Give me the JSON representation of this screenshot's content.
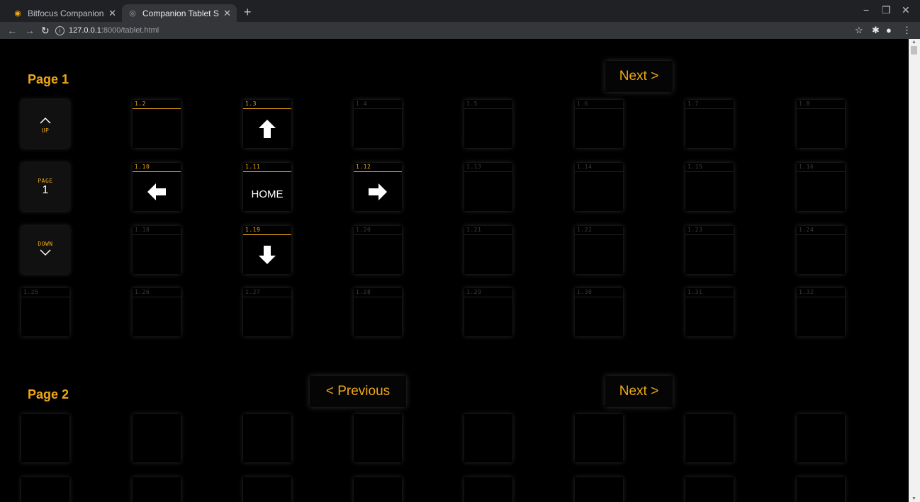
{
  "browser": {
    "tabs": [
      {
        "title": "Bitfocus Companion - Admin",
        "icon": "companion-icon",
        "active": false
      },
      {
        "title": "Companion Tablet Surface",
        "icon": "globe-icon",
        "active": true
      }
    ],
    "url_host": "127.0.0.1",
    "url_path": ":8000/tablet.html"
  },
  "pages": [
    {
      "title": "Page 1",
      "prev_label": "",
      "next_label": "Next >",
      "control": {
        "up": "UP",
        "page_label": "PAGE",
        "page_number": "1",
        "down": "DOWN"
      },
      "buttons": [
        {
          "code": "1.2",
          "lit": true,
          "face": ""
        },
        {
          "code": "1.3",
          "lit": true,
          "face": "arrow-up-icon"
        },
        {
          "code": "1.4",
          "lit": false,
          "face": ""
        },
        {
          "code": "1.5",
          "lit": false,
          "face": ""
        },
        {
          "code": "1.6",
          "lit": false,
          "face": ""
        },
        {
          "code": "1.7",
          "lit": false,
          "face": ""
        },
        {
          "code": "1.8",
          "lit": false,
          "face": ""
        },
        {
          "code": "1.10",
          "lit": true,
          "face": "arrow-left-icon"
        },
        {
          "code": "1.11",
          "lit": true,
          "face": "HOME"
        },
        {
          "code": "1.12",
          "lit": true,
          "face": "arrow-right-icon"
        },
        {
          "code": "1.13",
          "lit": false,
          "face": ""
        },
        {
          "code": "1.14",
          "lit": false,
          "face": ""
        },
        {
          "code": "1.15",
          "lit": false,
          "face": ""
        },
        {
          "code": "1.16",
          "lit": false,
          "face": ""
        },
        {
          "code": "1.18",
          "lit": false,
          "face": ""
        },
        {
          "code": "1.19",
          "lit": true,
          "face": "arrow-down-icon"
        },
        {
          "code": "1.20",
          "lit": false,
          "face": ""
        },
        {
          "code": "1.21",
          "lit": false,
          "face": ""
        },
        {
          "code": "1.22",
          "lit": false,
          "face": ""
        },
        {
          "code": "1.23",
          "lit": false,
          "face": ""
        },
        {
          "code": "1.24",
          "lit": false,
          "face": ""
        },
        {
          "code": "1.25",
          "lit": false,
          "face": ""
        },
        {
          "code": "1.26",
          "lit": false,
          "face": ""
        },
        {
          "code": "1.27",
          "lit": false,
          "face": ""
        },
        {
          "code": "1.28",
          "lit": false,
          "face": ""
        },
        {
          "code": "1.29",
          "lit": false,
          "face": ""
        },
        {
          "code": "1.30",
          "lit": false,
          "face": ""
        },
        {
          "code": "1.31",
          "lit": false,
          "face": ""
        },
        {
          "code": "1.32",
          "lit": false,
          "face": ""
        }
      ]
    },
    {
      "title": "Page 2",
      "prev_label": "< Previous",
      "next_label": "Next >"
    }
  ],
  "colors": {
    "accent": "#f0a813",
    "background": "#000000"
  }
}
